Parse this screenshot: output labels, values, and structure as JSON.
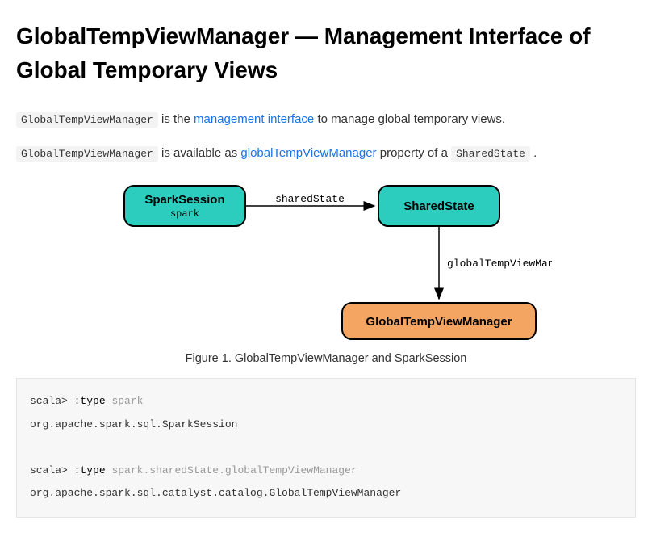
{
  "title": "GlobalTempViewManager — Management Interface of Global Temporary Views",
  "para1": {
    "code1": "GlobalTempViewManager",
    "t1": " is the ",
    "link1": "management interface",
    "t2": " to manage global temporary views."
  },
  "para2": {
    "code1": "GlobalTempViewManager",
    "t1": " is available as ",
    "link1": "globalTempViewManager",
    "t2": " property of a ",
    "code2": "SharedState",
    "t3": " ."
  },
  "diagram": {
    "sparkSession_main": "SparkSession",
    "sparkSession_sub": "spark",
    "sharedState_label": "sharedState",
    "sharedState_box": "SharedState",
    "globalTempViewManager_label": "globalTempViewManager",
    "gtvm_box": "GlobalTempViewManager"
  },
  "caption": "Figure 1. GlobalTempViewManager and SparkSession",
  "code": {
    "l1a": "scala> :",
    "l1b": "type",
    "l1c": " spark",
    "l2": "org.apache.spark.sql.SparkSession",
    "l3": "",
    "l4a": "scala> :",
    "l4b": "type",
    "l4c": " spark.sharedState.globalTempViewManager",
    "l5": "org.apache.spark.sql.catalyst.catalog.GlobalTempViewManager"
  }
}
